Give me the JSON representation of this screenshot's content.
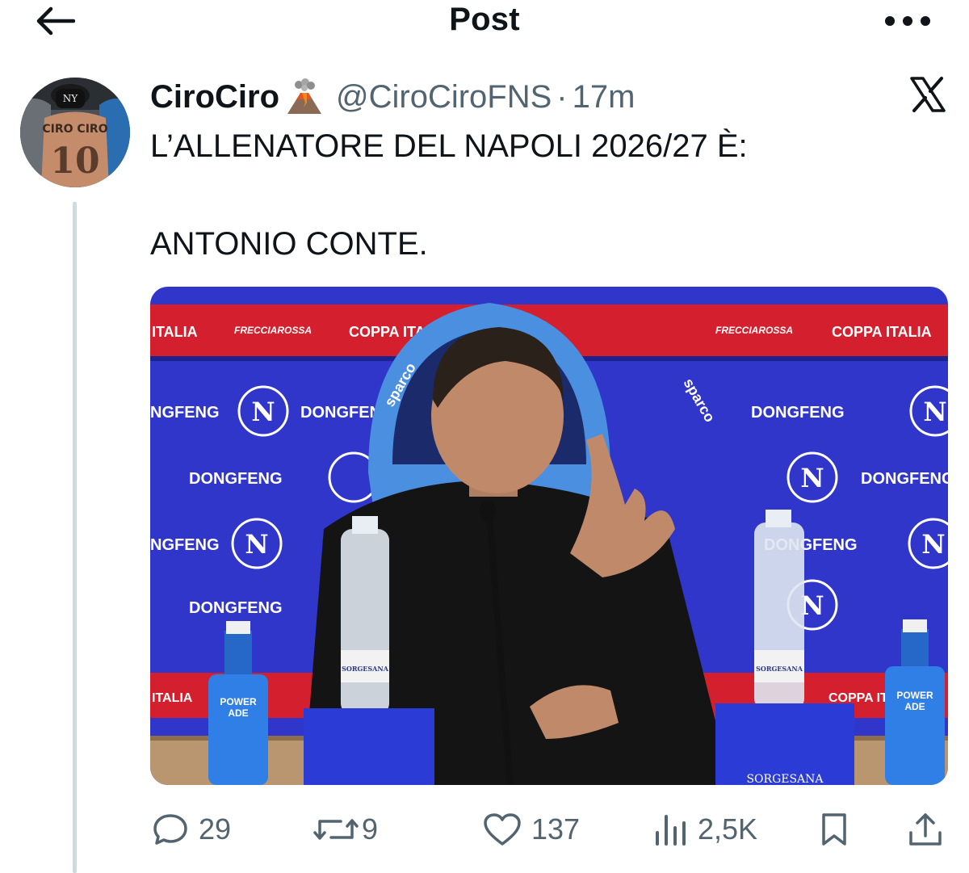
{
  "header": {
    "title": "Post",
    "back_icon": "arrow-left-icon",
    "more_icon": "ellipsis-icon"
  },
  "post": {
    "author": {
      "display_name": "CiroCiro",
      "emoji": "volcano-icon",
      "handle": "@CiroCiroFNS",
      "separator": "·",
      "time": "17m",
      "avatar_icon": "avatar-jersey-10"
    },
    "source_icon": "x-logo-icon",
    "text_line_1": "L’ALLENATORE DEL NAPOLI 2026/27 È:",
    "text_line_2": "ANTONIO CONTE.",
    "media": {
      "alt_icon": "press-conference-photo",
      "banner_text_1": "ITALIA",
      "banner_text_2": "FRECCIAROSSA",
      "banner_text_3": "COPPA ITALIA",
      "sponsor_text": "DONGFENG",
      "club_letter": "N",
      "chair_brand": "sparco",
      "bottle_brand": "SORGESANA",
      "drink_brand_1": "POWER",
      "drink_brand_2": "ADE"
    },
    "actions": {
      "replies": "29",
      "reposts": "9",
      "likes": "137",
      "views": "2,5K"
    }
  },
  "colors": {
    "text_primary": "#0f1419",
    "text_secondary": "#536471",
    "thread_line": "#cfd9de",
    "backdrop_blue": "#2f36c9",
    "banner_red": "#d4202e"
  }
}
